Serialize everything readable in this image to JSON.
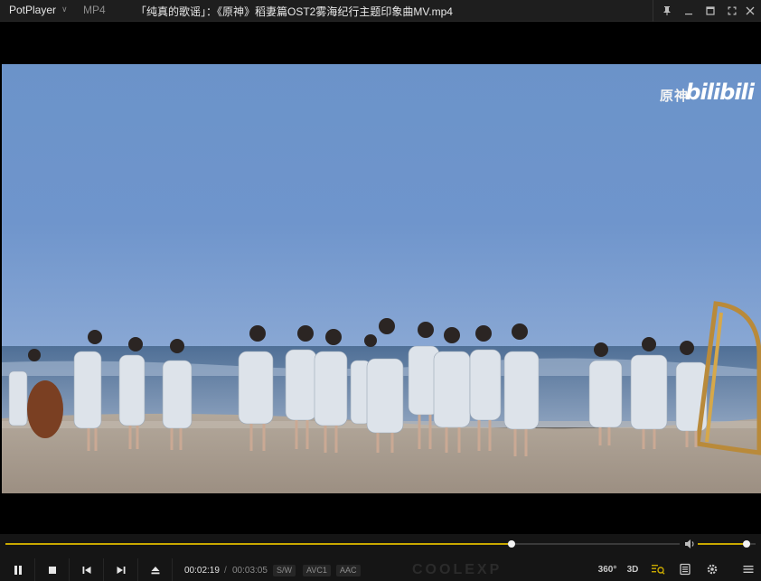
{
  "titlebar": {
    "app_name": "PotPlayer",
    "format": "MP4",
    "file_title": "「纯真的歌谣」：《原神》稻妻篇OST2雾海纪行主题印象曲MV.mp4"
  },
  "video": {
    "watermark_genshin": "原神",
    "watermark_bili": "bilibili"
  },
  "controls": {
    "time_current": "00:02:19",
    "time_separator": "/",
    "time_total": "00:03:05",
    "badge_sw": "S/W",
    "badge_video": "AVC1",
    "badge_audio": "AAC",
    "brand": "COOLEXP",
    "btn_360": "360°",
    "btn_3d": "3D",
    "progress": 0.75,
    "volume": 0.85,
    "accent_color": "#c8a800"
  }
}
